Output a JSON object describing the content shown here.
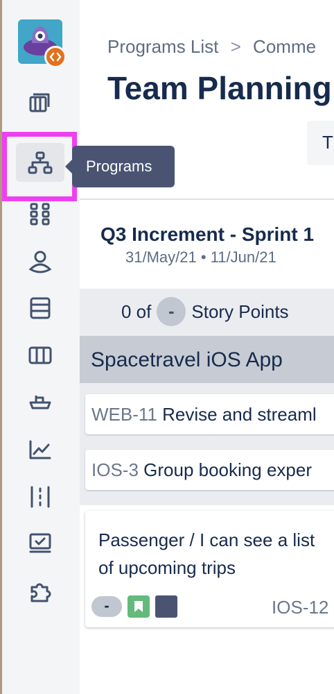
{
  "sidebar": {
    "items": [
      {
        "name": "backlog-icon"
      },
      {
        "name": "programs-icon",
        "active": true
      },
      {
        "name": "apps-grid-icon"
      },
      {
        "name": "user-icon"
      },
      {
        "name": "database-icon"
      },
      {
        "name": "board-columns-icon"
      },
      {
        "name": "ship-icon"
      },
      {
        "name": "chart-icon"
      },
      {
        "name": "dependencies-icon"
      },
      {
        "name": "presentation-icon"
      },
      {
        "name": "puzzle-icon"
      }
    ],
    "tooltip": "Programs"
  },
  "breadcrumb": {
    "first": "Programs List",
    "separator": ">",
    "second": "Comme"
  },
  "page_title": "Team Planning",
  "tab_stub": "T",
  "sprint": {
    "name": "Q3 Increment - Sprint 1",
    "start": "31/May/21",
    "dot": "•",
    "end": "11/Jun/21"
  },
  "story_points": {
    "prefix": "0 of",
    "value": "-",
    "suffix": "Story Points"
  },
  "team": {
    "name": "Spacetravel iOS App"
  },
  "issues": [
    {
      "key": "WEB-11",
      "summary": "Revise and streaml"
    },
    {
      "key": "IOS-3",
      "summary": "Group booking exper"
    }
  ],
  "card": {
    "title": "Passenger / I can see a list of upcoming trips",
    "estimate": "-",
    "key": "IOS-12"
  },
  "colors": {
    "highlight": "#ee40f0",
    "tooltip_bg": "#4a5472",
    "story_icon": "#63ba7c",
    "logo_bg": "#41a6c8",
    "logo_badge": "#e2711d"
  }
}
